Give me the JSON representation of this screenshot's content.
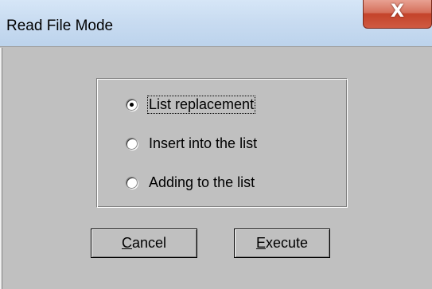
{
  "window": {
    "title": "Read File Mode",
    "close_glyph": "X"
  },
  "options": [
    {
      "label": "List replacement",
      "checked": true,
      "focused": true
    },
    {
      "label": "Insert into the list",
      "checked": false,
      "focused": false
    },
    {
      "label": "Adding to the list",
      "checked": false,
      "focused": false
    }
  ],
  "buttons": {
    "cancel": {
      "mnemonic": "C",
      "rest": "ancel"
    },
    "execute": {
      "mnemonic": "E",
      "rest": "xecute"
    }
  },
  "icons": {
    "close": "close-icon",
    "radio": "radio-button"
  },
  "colors": {
    "dialog_bg": "#c0c0c0",
    "titlebar": "#c9dcf1",
    "close_button": "#c4432a"
  }
}
